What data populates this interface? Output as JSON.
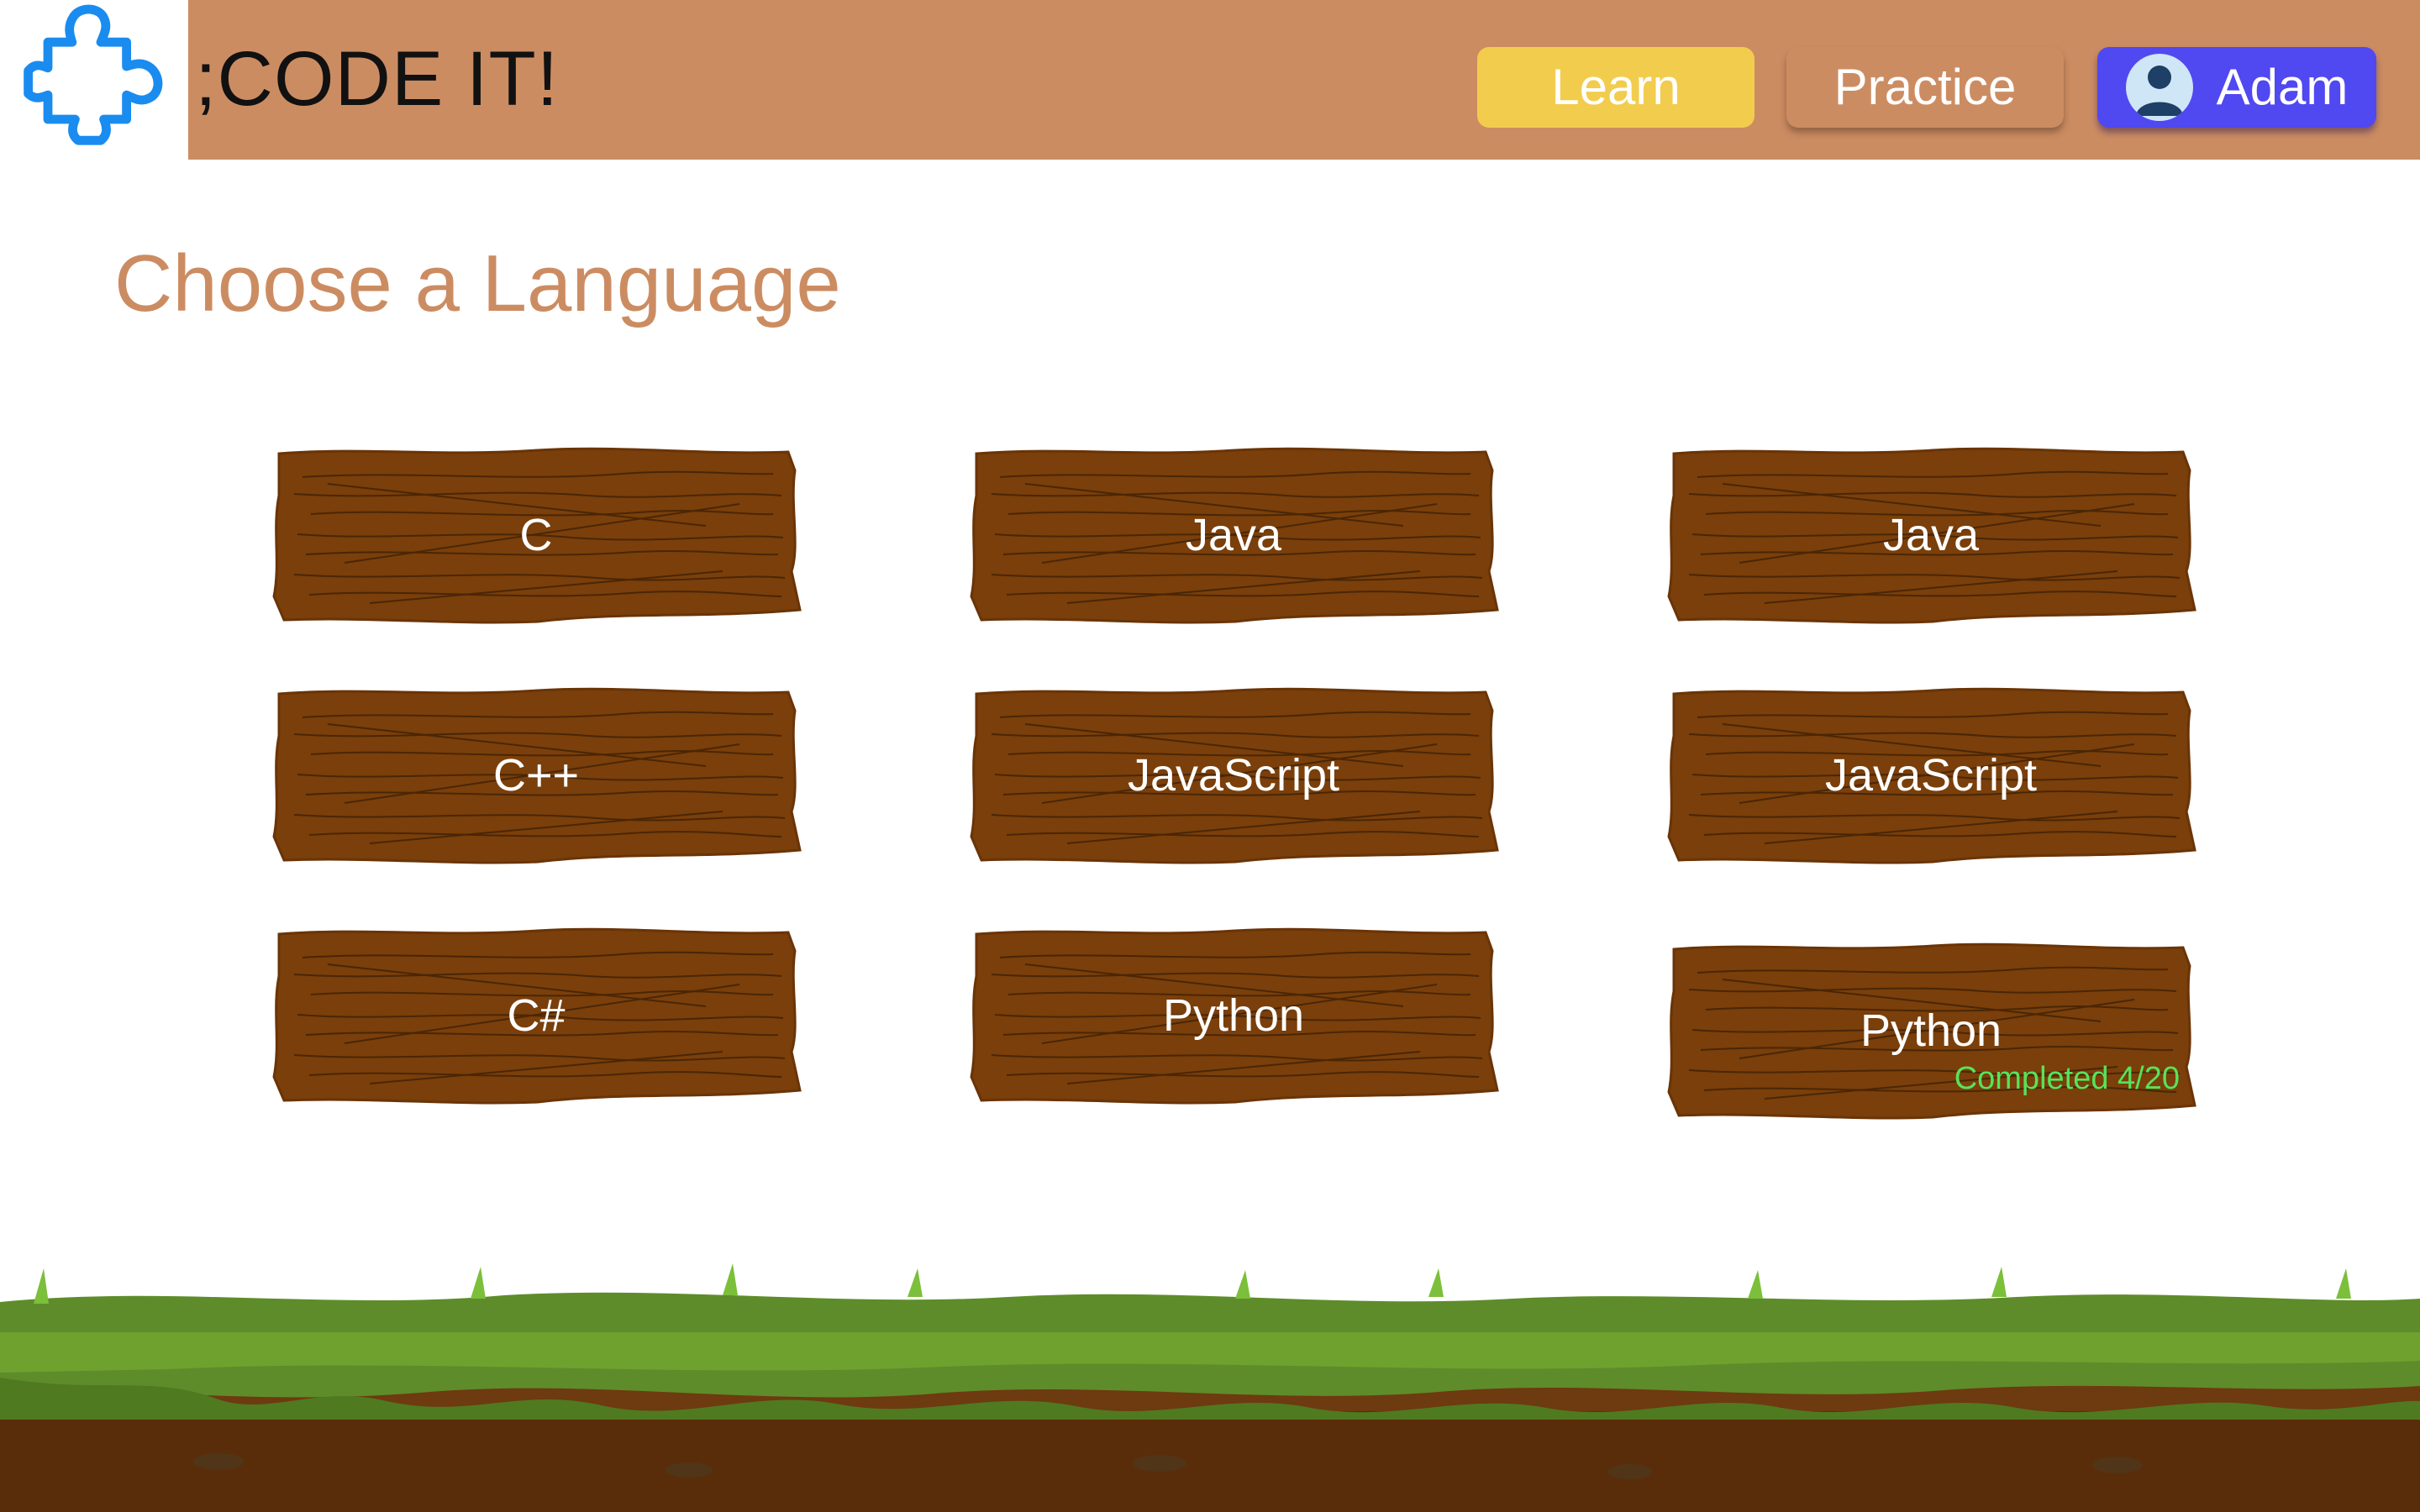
{
  "header": {
    "brand": ";CODE IT!",
    "logo_icon": "puzzle-piece-icon",
    "nav": {
      "learn": "Learn",
      "practice": "Practice",
      "user": "Adam"
    },
    "colors": {
      "bar": "#cc8c62",
      "learn": "#f2cc4d",
      "user": "#5048f0",
      "logo": "#1a8cf0"
    }
  },
  "main": {
    "title": "Choose a Language",
    "languages": [
      {
        "label": "C"
      },
      {
        "label": "Java"
      },
      {
        "label": "Java"
      },
      {
        "label": "C++"
      },
      {
        "label": "JavaScript"
      },
      {
        "label": "JavaScript"
      },
      {
        "label": "C#"
      },
      {
        "label": "Python"
      },
      {
        "label": "Python",
        "progress": "Completed 4/20"
      }
    ]
  }
}
